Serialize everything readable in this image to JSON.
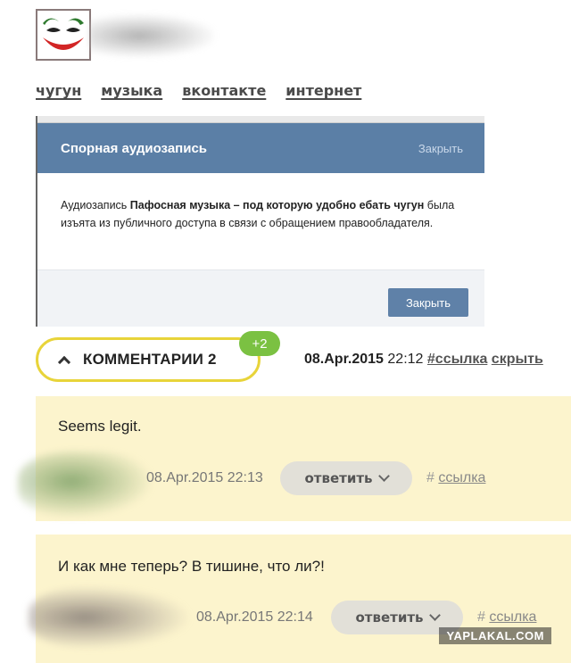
{
  "header": {
    "tags": [
      "чугун",
      "музыка",
      "вконтакте",
      "интернет"
    ]
  },
  "embedded_screenshot": {
    "title": "Спорная аудиозапись",
    "close_link": "Закрыть",
    "body_prefix": "Аудиозапись ",
    "body_bold": "Пафосная музыка – под которую удобно ебать чугун",
    "body_suffix": " была изъята из публичного доступа в связи с обращением правообладателя.",
    "close_button": "Закрыть"
  },
  "comments_bar": {
    "label": "КОММЕНТАРИИ 2",
    "badge": "+2",
    "date": "08.Apr.2015",
    "time": "22:12",
    "link_label": "#ссылка",
    "hide_label": "скрыть"
  },
  "comments": [
    {
      "text": "Seems legit.",
      "datetime": "08.Apr.2015 22:13",
      "reply_label": "ответить",
      "hash": "#",
      "link_label": "ссылка"
    },
    {
      "text": "И как мне теперь? В тишине, что ли?!",
      "datetime": "08.Apr.2015 22:14",
      "reply_label": "ответить",
      "hash": "#",
      "link_label": "ссылка"
    }
  ],
  "watermark": "YAPLAKAL.COM",
  "colors": {
    "vk_header": "#5b7fa6",
    "comment_bg": "#fcf4cd",
    "toggle_border": "#e8d43a",
    "badge_green": "#7bc142"
  },
  "icons": [
    "joker-avatar-icon",
    "chevron-up-icon",
    "chevron-down-icon"
  ]
}
